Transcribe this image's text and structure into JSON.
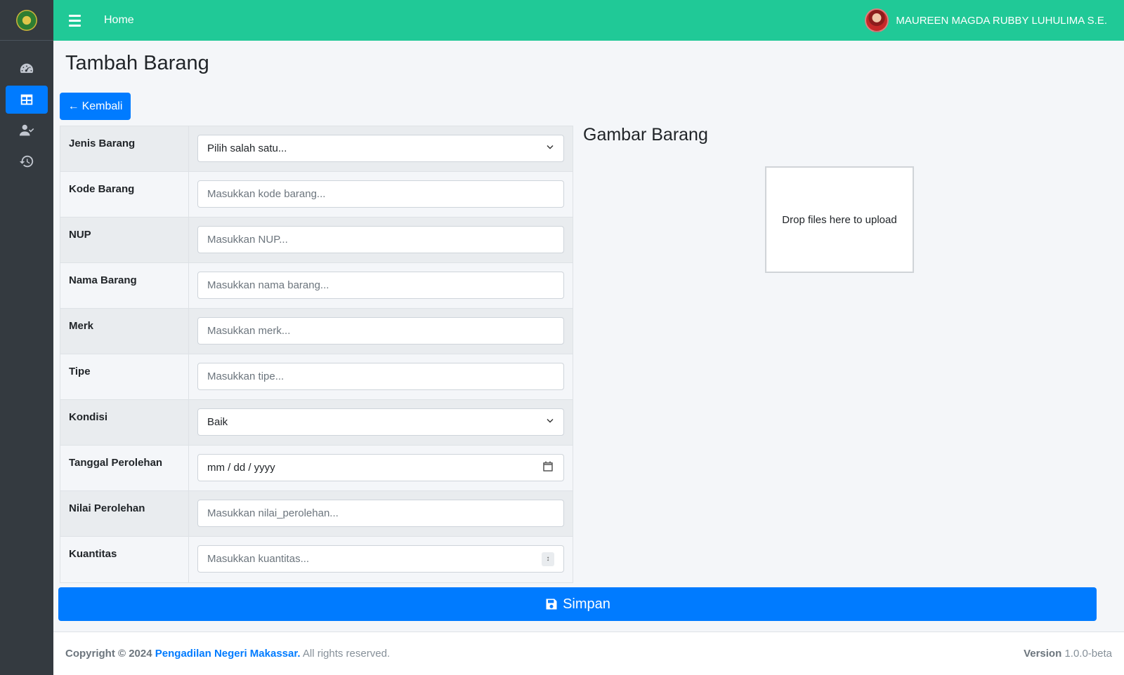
{
  "topbar": {
    "home_label": "Home",
    "user_name": "MAUREEN MAGDA RUBBY LUHULIMA S.E."
  },
  "sidebar": {
    "items": [
      {
        "icon": "tachometer-icon",
        "active": false
      },
      {
        "icon": "table-icon",
        "active": true
      },
      {
        "icon": "user-check-icon",
        "active": false
      },
      {
        "icon": "history-icon",
        "active": false
      }
    ]
  },
  "page": {
    "title": "Tambah Barang",
    "back_label": "Kembali",
    "gallery_title": "Gambar Barang",
    "dropzone_text": "Drop files here to upload",
    "save_label": "Simpan"
  },
  "form": {
    "jenis": {
      "label": "Jenis Barang",
      "value": "Pilih salah satu..."
    },
    "kode": {
      "label": "Kode Barang",
      "placeholder": "Masukkan kode barang..."
    },
    "nup": {
      "label": "NUP",
      "placeholder": "Masukkan NUP..."
    },
    "nama": {
      "label": "Nama Barang",
      "placeholder": "Masukkan nama barang..."
    },
    "merk": {
      "label": "Merk",
      "placeholder": "Masukkan merk..."
    },
    "tipe": {
      "label": "Tipe",
      "placeholder": "Masukkan tipe..."
    },
    "kondisi": {
      "label": "Kondisi",
      "value": "Baik"
    },
    "tanggal": {
      "label": "Tanggal Perolehan",
      "value": "mm / dd / yyyy"
    },
    "nilai": {
      "label": "Nilai Perolehan",
      "placeholder": "Masukkan nilai_perolehan..."
    },
    "kuantitas": {
      "label": "Kuantitas",
      "placeholder": "Masukkan kuantitas..."
    }
  },
  "footer": {
    "copyright_prefix": "Copyright © 2024",
    "brand": "Pengadilan Negeri Makassar.",
    "rights": "All rights reserved.",
    "version_label": "Version",
    "version_value": "1.0.0-beta"
  },
  "colors": {
    "topbar": "#20c997",
    "sidebar": "#343a40",
    "primary": "#007bff"
  }
}
